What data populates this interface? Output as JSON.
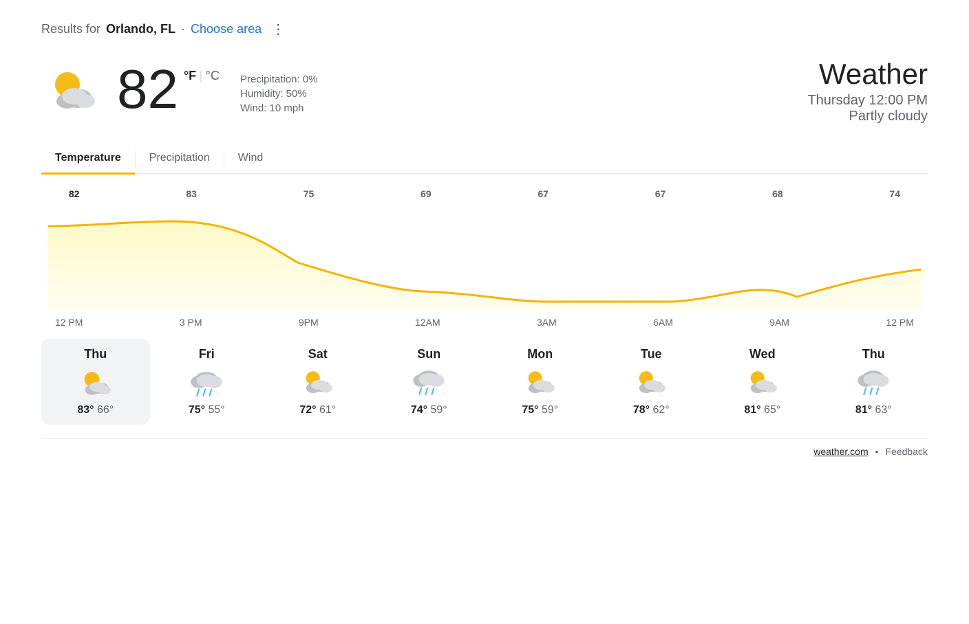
{
  "header": {
    "results_for": "Results for",
    "location": "Orlando, FL",
    "dot": "·",
    "choose_area": "Choose area",
    "more_icon": "⋮"
  },
  "weather": {
    "temperature": "82",
    "unit_f": "°F",
    "unit_separator": "|",
    "unit_c": "°C",
    "precipitation": "Precipitation: 0%",
    "humidity": "Humidity: 50%",
    "wind": "Wind: 10 mph",
    "title": "Weather",
    "datetime": "Thursday 12:00 PM",
    "condition": "Partly cloudy"
  },
  "tabs": [
    {
      "label": "Temperature",
      "active": true
    },
    {
      "label": "Precipitation",
      "active": false
    },
    {
      "label": "Wind",
      "active": false
    }
  ],
  "chart": {
    "temp_labels": [
      {
        "value": "82",
        "bold": true
      },
      {
        "value": "83",
        "bold": false
      },
      {
        "value": "75",
        "bold": false
      },
      {
        "value": "69",
        "bold": false
      },
      {
        "value": "67",
        "bold": false
      },
      {
        "value": "67",
        "bold": false
      },
      {
        "value": "68",
        "bold": false
      },
      {
        "value": "74",
        "bold": false
      }
    ],
    "time_labels": [
      "12 PM",
      "3 PM",
      "9 PM",
      "12 AM",
      "3 AM",
      "6 AM",
      "9 AM",
      "12 PM"
    ]
  },
  "daily": [
    {
      "day": "Thu",
      "high": "83°",
      "low": "66°",
      "active": true,
      "icon": "partly_cloudy"
    },
    {
      "day": "Fri",
      "high": "75°",
      "low": "55°",
      "active": false,
      "icon": "rainy"
    },
    {
      "day": "Sat",
      "high": "72°",
      "low": "61°",
      "active": false,
      "icon": "partly_cloudy"
    },
    {
      "day": "Sun",
      "high": "74°",
      "low": "59°",
      "active": false,
      "icon": "rainy_cloud"
    },
    {
      "day": "Mon",
      "high": "75°",
      "low": "59°",
      "active": false,
      "icon": "partly_cloudy"
    },
    {
      "day": "Tue",
      "high": "78°",
      "low": "62°",
      "active": false,
      "icon": "partly_cloudy"
    },
    {
      "day": "Wed",
      "high": "81°",
      "low": "65°",
      "active": false,
      "icon": "partly_cloudy"
    },
    {
      "day": "Thu",
      "high": "81°",
      "low": "63°",
      "active": false,
      "icon": "rainy"
    }
  ],
  "footer": {
    "source": "weather.com",
    "feedback": "Feedback"
  }
}
